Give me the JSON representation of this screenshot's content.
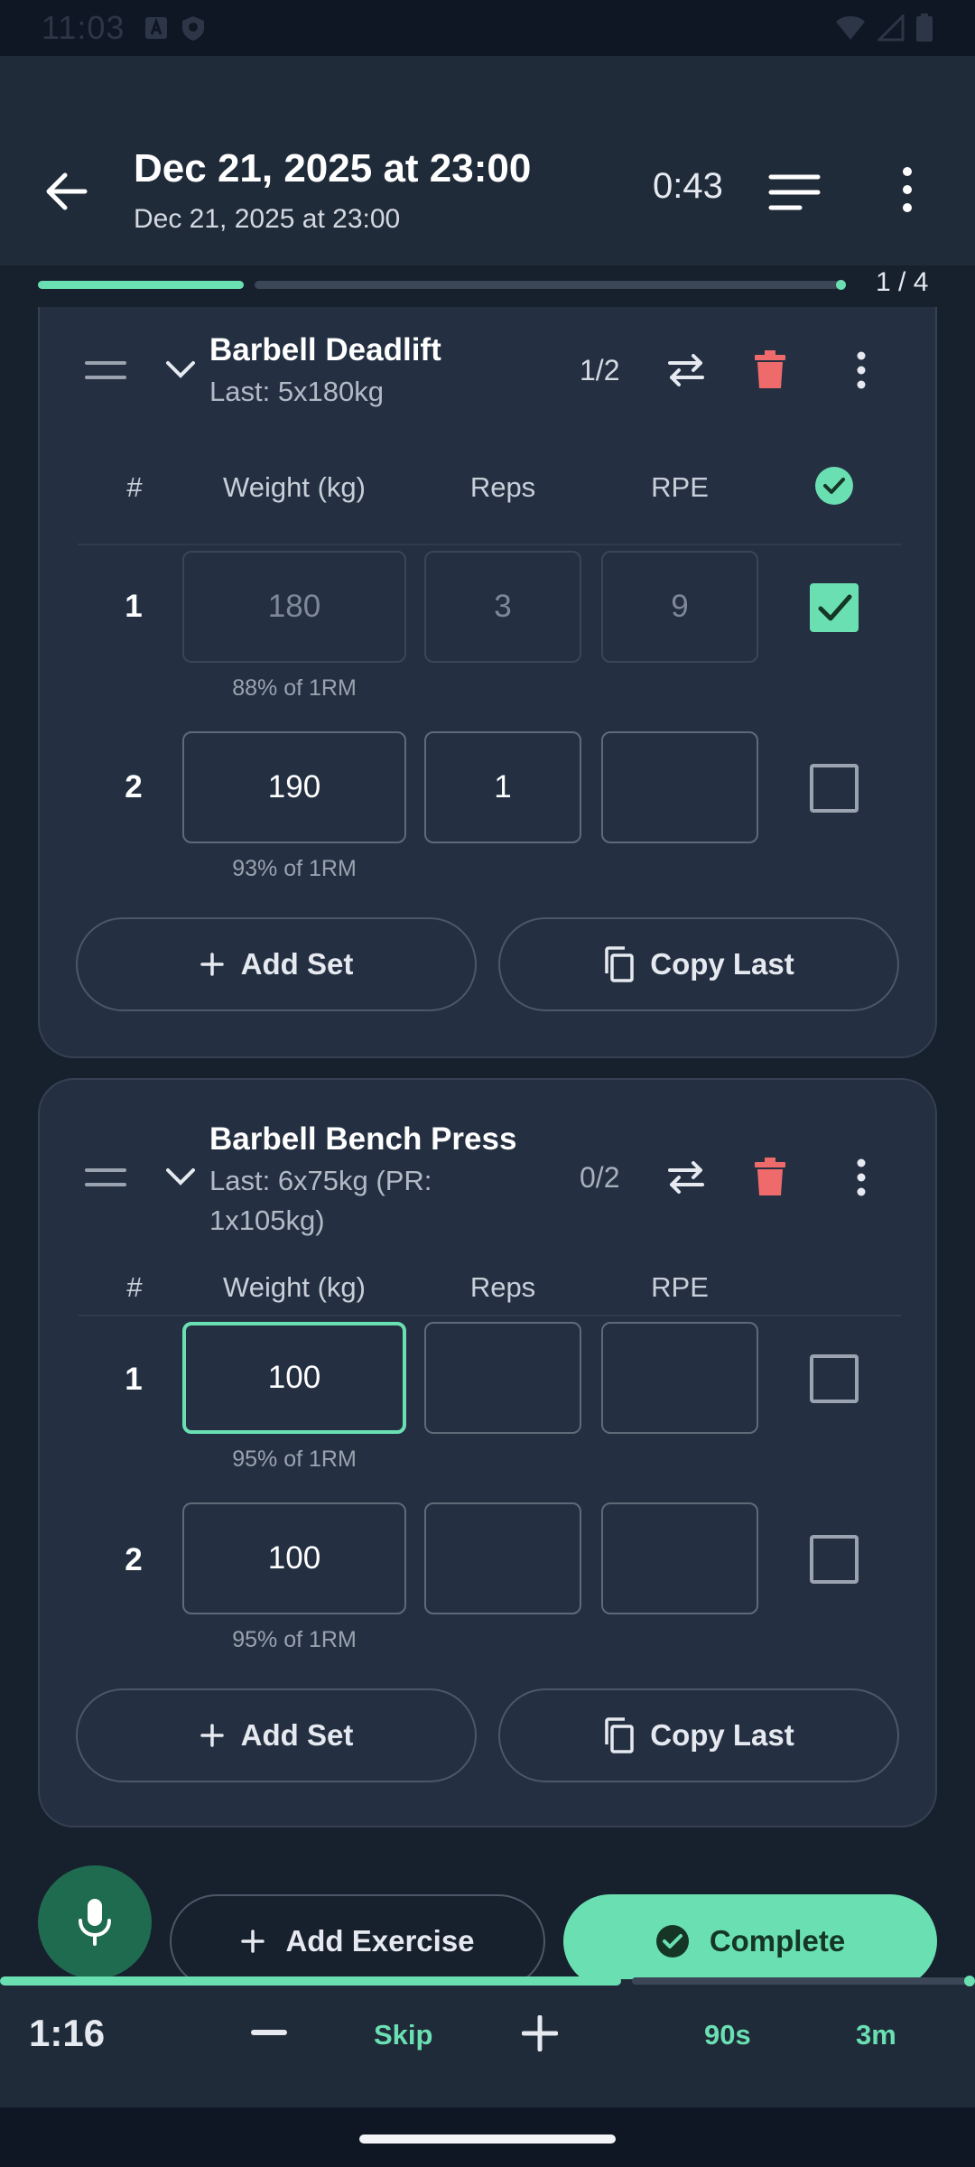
{
  "status_bar": {
    "time": "11:03"
  },
  "header": {
    "title": "Dec 21, 2025 at 23:00",
    "subtitle": "Dec 21, 2025 at 23:00",
    "elapsed": "0:43"
  },
  "workout_progress": {
    "label": "1 / 4",
    "fraction": 0.25
  },
  "table_headers": {
    "number": "#",
    "weight": "Weight (kg)",
    "reps": "Reps",
    "rpe": "RPE"
  },
  "exercises": [
    {
      "name": "Barbell Deadlift",
      "last": "Last: 5x180kg",
      "count": "1/2",
      "sets": [
        {
          "num": "1",
          "weight": "180",
          "reps": "3",
          "rpe": "9",
          "pct": "88% of 1RM",
          "completed": true
        },
        {
          "num": "2",
          "weight": "190",
          "reps": "1",
          "rpe": "",
          "pct": "93% of 1RM",
          "completed": false
        }
      ]
    },
    {
      "name": "Barbell Bench Press",
      "last": "Last: 6x75kg (PR: 1x105kg)",
      "count": "0/2",
      "sets": [
        {
          "num": "1",
          "weight": "100",
          "reps": "",
          "rpe": "",
          "pct": "95% of 1RM",
          "completed": false
        },
        {
          "num": "2",
          "weight": "100",
          "reps": "",
          "rpe": "",
          "pct": "95% of 1RM",
          "completed": false
        }
      ]
    }
  ],
  "buttons": {
    "add_set": "Add Set",
    "copy_last": "Copy Last",
    "add_exercise": "Add Exercise",
    "complete": "Complete"
  },
  "rest_timer": {
    "time": "1:16",
    "skip": "Skip",
    "preset_1": "90s",
    "preset_2": "3m",
    "progress_fraction": 0.64
  },
  "colors": {
    "accent": "#6ae0b2",
    "delete": "#ef6b6b",
    "background": "#17202d",
    "card": "#243042"
  },
  "icons": {
    "back": "arrow-left-icon",
    "list": "list-icon",
    "more": "more-vert-icon",
    "drag": "drag-handle-icon",
    "collapse": "chevron-down-icon",
    "swap": "swap-icon",
    "delete": "trash-icon",
    "mic": "mic-icon",
    "add": "plus-icon",
    "copy": "copy-icon",
    "complete": "check-circle-icon"
  }
}
